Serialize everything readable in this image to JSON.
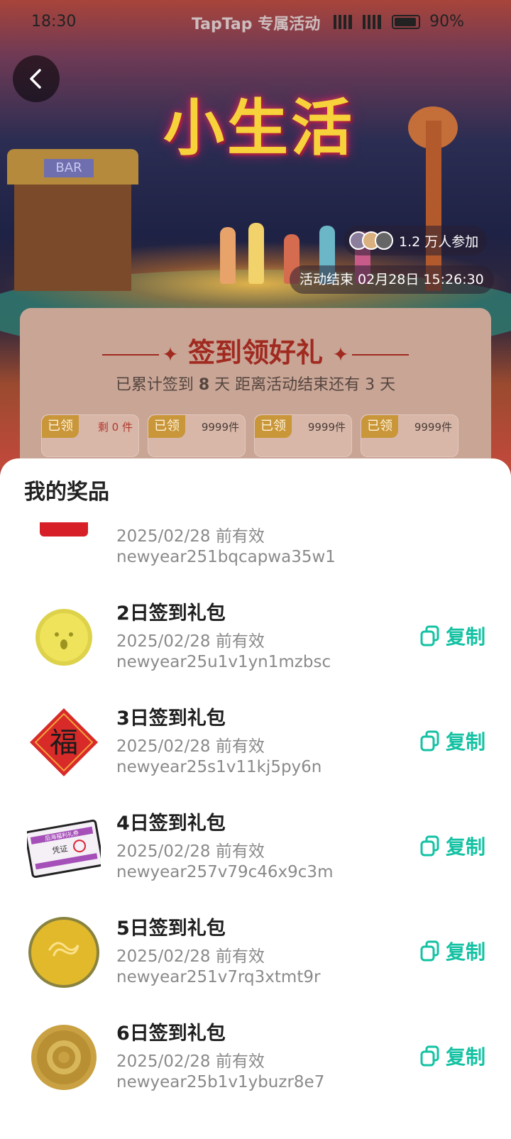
{
  "status_bar": {
    "time": "18:30",
    "center": "TapTap 专属活动",
    "network": "5G 5G",
    "battery": "90%"
  },
  "banner": {
    "title": "小生活",
    "bar_sign": "BAR",
    "participants": "1.2 万人参加",
    "ends": "活动结束 02月28日 15:26:30"
  },
  "signin": {
    "heading": "签到领好礼",
    "stats_prefix": "已累计签到",
    "days": "8",
    "stats_mid": "天  距离活动结束还有",
    "days_left": "3",
    "stats_suffix": "天",
    "slots": [
      {
        "tag": "已领",
        "count": "剩 0 件"
      },
      {
        "tag": "已领",
        "count": "9999件"
      },
      {
        "tag": "已领",
        "count": "9999件"
      },
      {
        "tag": "已领",
        "count": "9999件"
      }
    ]
  },
  "sheet": {
    "title": "我的奖品",
    "copy_label": "复制",
    "items": [
      {
        "name": "",
        "valid": "2025/02/28 前有效",
        "code": "newyear251bqcapwa35w1",
        "icon": "red-envelope-fu-icon"
      },
      {
        "name": "2日签到礼包",
        "valid": "2025/02/28 前有效",
        "code": "newyear25u1v1yn1mzbsc",
        "icon": "yellow-coin-icon"
      },
      {
        "name": "3日签到礼包",
        "valid": "2025/02/28 前有效",
        "code": "newyear25s1v11kj5py6n",
        "icon": "fu-diamond-icon"
      },
      {
        "name": "4日签到礼包",
        "valid": "2025/02/28 前有效",
        "code": "newyear257v79c46x9c3m",
        "icon": "voucher-ticket-icon"
      },
      {
        "name": "5日签到礼包",
        "valid": "2025/02/28 前有效",
        "code": "newyear251v7rq3xtmt9r",
        "icon": "gold-snake-coin-icon"
      },
      {
        "name": "6日签到礼包",
        "valid": "2025/02/28 前有效",
        "code": "newyear25b1v1ybuzr8e7",
        "icon": "bronze-coin-icon"
      }
    ],
    "ticket_text_1": "后海福利礼券",
    "ticket_text_2": "凭证",
    "fu_char": "福"
  },
  "colors": {
    "accent": "#14c2a3",
    "banner_title": "#f7d23a",
    "heading_red": "#a02a20"
  }
}
